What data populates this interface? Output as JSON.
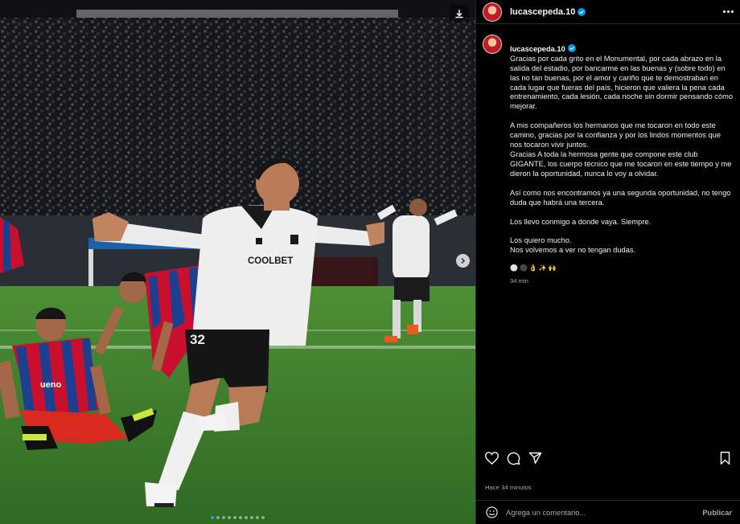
{
  "colors": {
    "panel_bg": "#000000",
    "text": "#f5f5f5",
    "muted": "#a8a8a8",
    "verified": "#0095f6",
    "shirt_white": "#eeeeee",
    "rival_red": "#c8102e",
    "rival_blue": "#1d3f8f",
    "pitch_green": "#3f8a2e"
  },
  "photo": {
    "description_icons": {
      "download": "download-icon",
      "next": "chevron-right-icon"
    },
    "shirt_sponsor": "COOLBET",
    "shirt_number": "32",
    "rival_sponsor": "ueno",
    "carousel_count": 10,
    "carousel_active": 0
  },
  "header": {
    "username": "lucascepeda.10",
    "verified": true
  },
  "caption": {
    "username": "lucascepeda.10",
    "paragraphs": [
      "Gracias por cada grito en el Monumental, por cada abrazo en la salida del estadio, por bancarme en las buenas y (sobre todo) en las no tan buenas, por el amor y cariño que te demostraban en cada lugar que fueras del país, hicieron que valiera la pena cada entrenamiento, cada lesión, cada noche sin dormir pensando cómo mejorar.",
      "A mis compañeros los hermanos que me tocaron en todo este camino, gracias por la confianza y por los lindos momentos que nos tocaron vivir juntos.\nGracias A toda la hermosa gente que compone este club GIGANTE, los cuerpo técnico que me tocaron en este tiempo y me dieron la oportunidad, nunca lo voy a olvidar.",
      "Así como nos encontramos ya una segunda oportunidad, no tengo duda que habrá una tercera.",
      "Los llevo conmigo a donde vaya. Siempre.",
      "Los quiero mucho.\nNos volvemos a ver no tengan dudas."
    ],
    "emojis": "⚪⚫👌✨🙌",
    "time_ago": "34 min"
  },
  "actions": {
    "like_icon": "heart-icon",
    "comment_icon": "comment-icon",
    "share_icon": "share-icon",
    "save_icon": "bookmark-icon"
  },
  "posted": "Hace 34 minutos",
  "comment": {
    "placeholder": "Agrega un comentario...",
    "publish": "Publicar"
  }
}
